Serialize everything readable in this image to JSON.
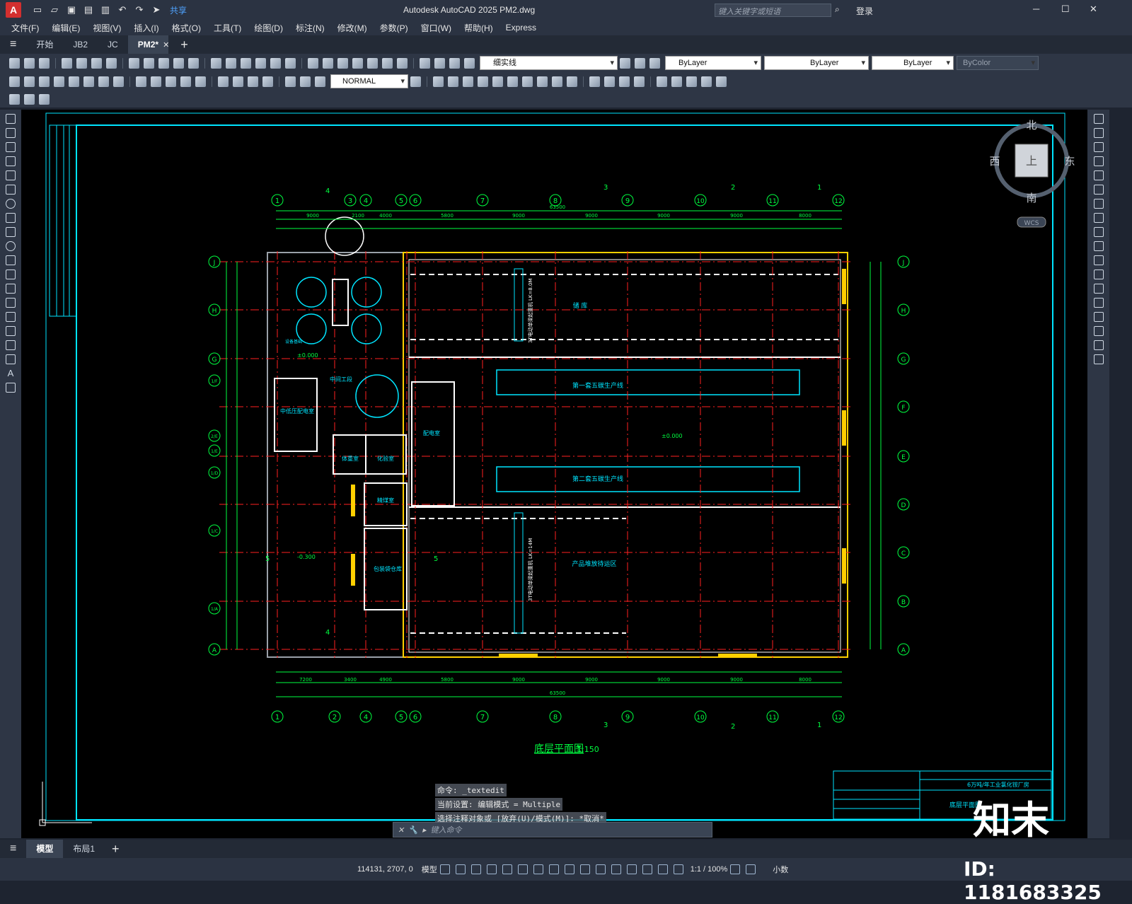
{
  "titlebar": {
    "app_logo": "A",
    "share": "共享",
    "title": "Autodesk AutoCAD 2025    PM2.dwg",
    "search_placeholder": "键入关键字或短语",
    "login": "登录"
  },
  "menu": [
    "文件(F)",
    "编辑(E)",
    "视图(V)",
    "插入(I)",
    "格式(O)",
    "工具(T)",
    "绘图(D)",
    "标注(N)",
    "修改(M)",
    "参数(P)",
    "窗口(W)",
    "帮助(H)",
    "Express"
  ],
  "tabs": [
    {
      "label": "开始"
    },
    {
      "label": "JB2"
    },
    {
      "label": "JC"
    },
    {
      "label": "PM2*"
    }
  ],
  "toolbar": {
    "layer_name": "细实线",
    "color": "ByLayer",
    "linetype": "ByLayer",
    "lineweight": "ByLayer",
    "plotstyle": "ByColor",
    "dimstyle": "NORMAL"
  },
  "compass": {
    "north": "北",
    "south": "南",
    "east": "东",
    "west": "西",
    "top": "上",
    "wcs": "WCS"
  },
  "drawing": {
    "title": "底层平面图",
    "scale": "1:150",
    "grid_top": [
      "①",
      "③",
      "④",
      "⑤",
      "⑥",
      "⑦",
      "⑧",
      "⑨",
      "⑩",
      "⑪",
      "⑫"
    ],
    "grid_top_text": [
      "1",
      "3",
      "4",
      "5",
      "6",
      "7",
      "8",
      "9",
      "10",
      "11",
      "12"
    ],
    "grid_bottom_text": [
      "1",
      "2",
      "4",
      "5",
      "6",
      "7",
      "8",
      "9",
      "10",
      "11",
      "12"
    ],
    "grid_left": [
      "J",
      "H",
      "G",
      "1/F",
      "2/E",
      "1/E",
      "1/D",
      "1/C",
      "1/A",
      "A"
    ],
    "grid_right": [
      "J",
      "H",
      "G",
      "F",
      "E",
      "D",
      "C",
      "B",
      "A"
    ],
    "rooms": [
      {
        "label": "储    库"
      },
      {
        "label": "第一套五碳生产线"
      },
      {
        "label": "第二套五碳生产线"
      },
      {
        "label": "产品堆放待运区"
      },
      {
        "label": "中低压配电室"
      },
      {
        "label": "中间工段"
      },
      {
        "label": "配电室"
      },
      {
        "label": "体重室"
      },
      {
        "label": "化验室"
      },
      {
        "label": "精煤室"
      },
      {
        "label": "包装袋仓库"
      },
      {
        "label": "设备基础"
      }
    ],
    "crane1": "3T电动单梁起重机 LK=8.0M",
    "crane2": "3T电动单梁起重机 LK=14M",
    "elev_main": "±0.000",
    "elev_low": "-0.300",
    "total_dim": "63500",
    "dims_top": [
      "9000",
      "2100",
      "4000",
      "5800",
      "9000",
      "9000",
      "9000",
      "9000",
      "8000"
    ],
    "dims_bottom": [
      "7200",
      "3400",
      "4900",
      "5800",
      "9000",
      "9000",
      "9000",
      "9000",
      "8000"
    ],
    "section_marks": [
      "4",
      "3",
      "2",
      "1",
      "5",
      "5",
      "4",
      "3",
      "2",
      "1"
    ]
  },
  "titleblock": {
    "project": "6万吨/年工业氯化铵厂房",
    "sheet": "底层平面图"
  },
  "command": {
    "history": [
      "命令: _textedit",
      "当前设置: 编辑模式 = Multiple",
      "选择注释对象或 [放弃(U)/模式(M)]: *取消*"
    ],
    "placeholder": "键入命令"
  },
  "layout_tabs": [
    "模型",
    "布局1"
  ],
  "status": {
    "coords": "114131, 2707, 0",
    "model": "模型",
    "scale": "1:1 / 100%",
    "units": "小数"
  },
  "watermark": {
    "logo": "知末",
    "id": "ID: 1181683325"
  },
  "colors": {
    "canvas": "#000000",
    "cyan": "#00e5ff",
    "green": "#00ff40",
    "red": "#ff2020",
    "yellow": "#ffd000",
    "white": "#ffffff"
  }
}
